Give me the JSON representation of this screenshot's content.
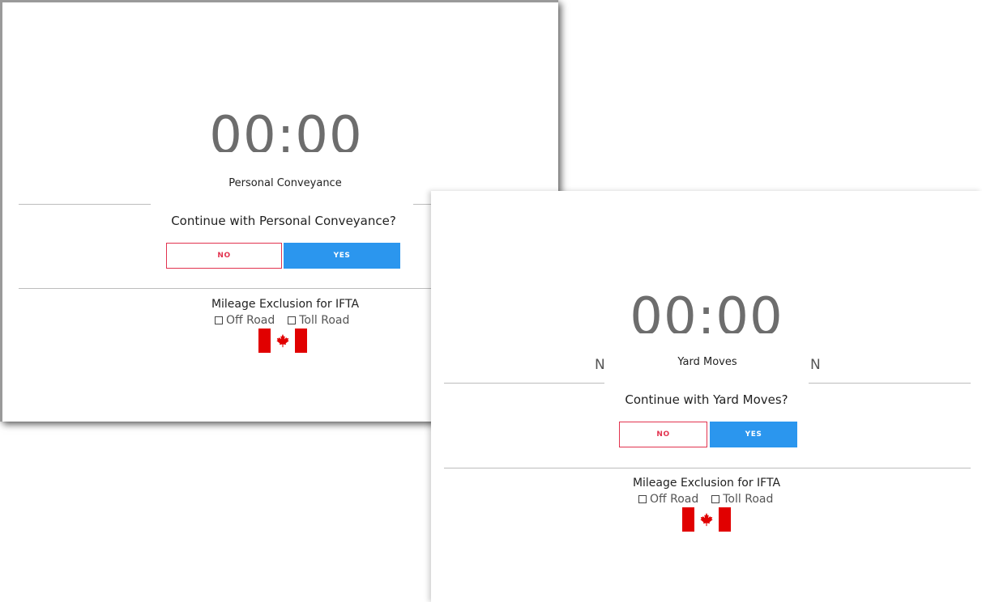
{
  "left_panel": {
    "timer": "00:00",
    "status_title": "Personal Conveyance",
    "question": "Continue with Personal Conveyance?",
    "no_label": "NO",
    "yes_label": "YES",
    "mileage_title": "Mileage Exclusion for IFTA",
    "off_road_label": "Off Road",
    "toll_road_label": "Toll Road",
    "flag_icon": "canada-flag-icon"
  },
  "right_panel": {
    "timer": "00:00",
    "status_title": "Yard Moves",
    "bg_letter_left": "N",
    "bg_letter_right": "N",
    "question": "Continue with Yard Moves?",
    "no_label": "NO",
    "yes_label": "YES",
    "mileage_title": "Mileage Exclusion for IFTA",
    "off_road_label": "Off Road",
    "toll_road_label": "Toll Road",
    "flag_icon": "canada-flag-icon"
  },
  "colors": {
    "no_border": "#e2334f",
    "yes_background": "#2b96ee",
    "flag_red": "#e10000"
  }
}
